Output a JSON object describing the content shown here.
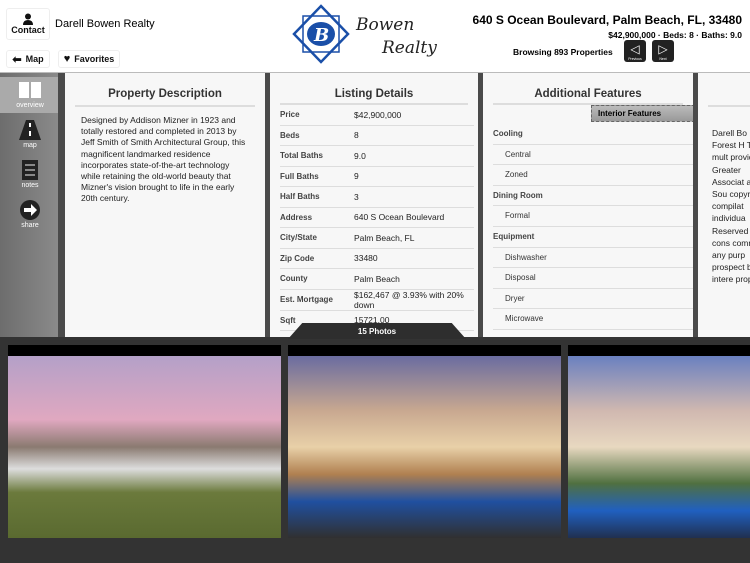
{
  "header": {
    "contact_label": "Contact",
    "agent_name": "Darell Bowen Realty",
    "map_label": "Map",
    "favorites_label": "Favorites",
    "logo_text": "Bowen Realty",
    "logo_line1": "Bowen",
    "logo_line2": "Realty",
    "address": "640 S Ocean Boulevard, Palm Beach, FL, 33480",
    "summary": "$42,900,000 · Beds: 8 · Baths: 9.0",
    "browsing": "Browsing 893 Properties",
    "previous_label": "Previous",
    "next_label": "Next"
  },
  "sidebar": {
    "items": [
      {
        "label": "overview",
        "icon": "overview-icon",
        "active": true
      },
      {
        "label": "map",
        "icon": "road-icon"
      },
      {
        "label": "notes",
        "icon": "notes-icon"
      },
      {
        "label": "share",
        "icon": "share-arrow-icon"
      }
    ]
  },
  "description": {
    "title": "Property Description",
    "text": "Designed by Addison Mizner in 1923 and totally restored and completed in 2013 by Jeff Smith of Smith Architectural Group, this magnificent landmarked residence incorporates state-of-the-art technology while retaining the old-world beauty that Mizner's vision brought to life in the early 20th century."
  },
  "listing": {
    "title": "Listing Details",
    "rows": [
      {
        "k": "Price",
        "v": "$42,900,000"
      },
      {
        "k": "Beds",
        "v": "8"
      },
      {
        "k": "Total Baths",
        "v": "9.0"
      },
      {
        "k": "Full Baths",
        "v": "9"
      },
      {
        "k": "Half Baths",
        "v": "3"
      },
      {
        "k": "Address",
        "v": "640 S Ocean Boulevard"
      },
      {
        "k": "City/State",
        "v": "Palm Beach, FL"
      },
      {
        "k": "Zip Code",
        "v": "33480"
      },
      {
        "k": "County",
        "v": "Palm Beach"
      },
      {
        "k": "Est. Mortgage",
        "v": "$162,467 @ 3.93% with 20% down"
      },
      {
        "k": "Sqft",
        "v": "15721.00"
      }
    ]
  },
  "features": {
    "title": "Additional Features",
    "tab": "Interior Features",
    "rows": [
      {
        "t": "Cooling",
        "h": true
      },
      {
        "t": "Central"
      },
      {
        "t": "Zoned"
      },
      {
        "t": "Dining Room",
        "h": true
      },
      {
        "t": "Formal"
      },
      {
        "t": "Equipment",
        "h": true
      },
      {
        "t": "Dishwasher"
      },
      {
        "t": "Disposal"
      },
      {
        "t": "Dryer"
      },
      {
        "t": "Microwave"
      }
    ]
  },
  "disclaimer": {
    "text": "Darell Bo Forest H The mult provided Greater Associat and Sou copyrigh compilat individua Reserved for cons commerc any purp prospect be intere properti"
  },
  "photos": {
    "count_label": "15 Photos"
  }
}
